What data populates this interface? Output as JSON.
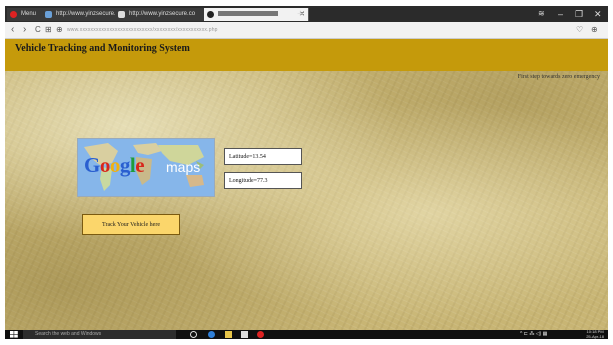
{
  "browser": {
    "tabs": [
      {
        "label": "Menu",
        "icon": "opera-icon"
      },
      {
        "label": "http://www.yinzsecure.co",
        "icon": "page-icon"
      },
      {
        "label": "http://www.yinzsecure.co",
        "icon": "page-icon"
      },
      {
        "label": "",
        "icon": "page-icon"
      }
    ],
    "new_tab": "+",
    "window_controls": {
      "minimize": "–",
      "maximize": "❐",
      "close": "✕"
    },
    "nav": {
      "back": "‹",
      "forward": "›",
      "reload": "C",
      "grid": "⊞",
      "secure": "⊕"
    },
    "url": "www.xxxxxxxxxxxxxxxxxxxxxxxxxxx/xxxxxxxx/xxxxxxxxxxx.php",
    "addr_right": {
      "heart": "♡",
      "download": "⊕"
    }
  },
  "page": {
    "title": "Vehicle Tracking and Monitoring System",
    "tagline": "First step towards zero emergency",
    "map_logo_text": "Google maps",
    "latitude": "Latitude=13.54",
    "longitude": "Longitude=77.3",
    "track_button": "Track Your Vehicle here"
  },
  "taskbar": {
    "search_placeholder": "Search the web and Windows",
    "tray": "^ ⊏ ⁂ ◁) ▦",
    "time": "10:18 PM",
    "date": "25-Apr-18"
  },
  "colors": {
    "header": "#c59a0b",
    "button": "#fbd66b",
    "page_texture": "#c8b574"
  }
}
